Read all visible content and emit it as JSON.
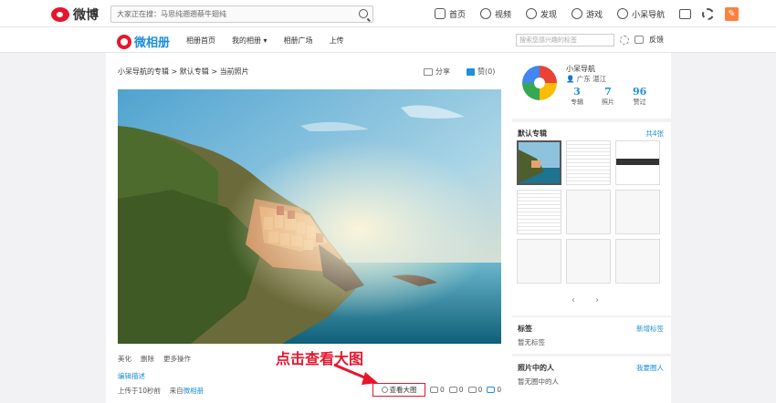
{
  "topbar": {
    "logo_text": "微博",
    "search_placeholder": "大家正在搜：马思纯遡遡蔡牛翅纯",
    "nav": [
      {
        "label": "首页",
        "icon": "home-icon"
      },
      {
        "label": "视频",
        "icon": "video-icon"
      },
      {
        "label": "发现",
        "icon": "compass-icon"
      },
      {
        "label": "游戏",
        "icon": "gamepad-icon"
      },
      {
        "label": "小呆导航",
        "icon": "user-icon"
      }
    ],
    "right_icons": [
      "mail-icon",
      "gear-icon",
      "compose-icon"
    ],
    "compose_glyph": "✎"
  },
  "subnav": {
    "logo_text": "微相册",
    "links": [
      "相册首页",
      "我的相册 ▾",
      "相册广场",
      "上传"
    ],
    "tag_search_placeholder": "搜索您感兴趣的标签",
    "feedback": "反馈"
  },
  "main": {
    "breadcrumb": [
      "小呆导航的专辑",
      "默认专辑",
      "当前照片"
    ],
    "share_label": "分享",
    "like_label": "赞(0)",
    "tools": [
      "美化",
      "删除",
      "更多操作"
    ],
    "edit_desc": "编辑描述",
    "upload_time": "上传于10秒前",
    "from_label": "来自",
    "from_source": "微相册",
    "view_large": "查看大图",
    "stats": {
      "views": "0",
      "forwards": "0",
      "comments": "0",
      "likes": "0"
    },
    "annotation": "点击查看大图"
  },
  "side": {
    "profile": {
      "name": "小呆导航",
      "location": "广东 湛江",
      "albums": "3",
      "albums_label": "专辑",
      "photos": "7",
      "photos_label": "照片",
      "likes": "96",
      "likes_label": "赞过"
    },
    "album": {
      "title": "默认专辑",
      "count": "共4张",
      "prev": "‹",
      "next": "›"
    },
    "tags": {
      "title": "标签",
      "action": "新增标签",
      "empty": "暂无标签"
    },
    "people": {
      "title": "照片中的人",
      "action": "我要圈人",
      "empty": "暂无圈中的人"
    }
  },
  "colors": {
    "brand_red": "#e6162d",
    "link_blue": "#1e8fd9",
    "orange": "#ff8140"
  }
}
